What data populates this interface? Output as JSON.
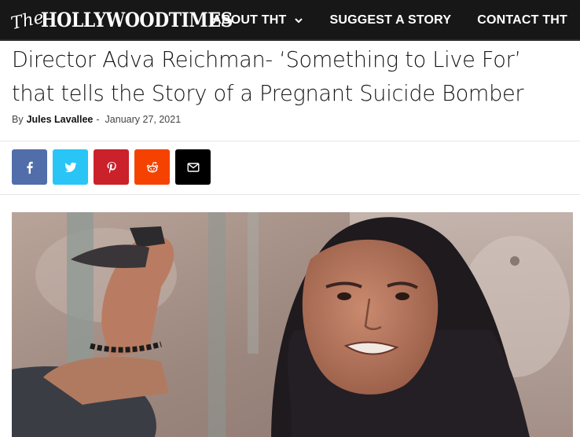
{
  "site": {
    "logo_the": "The",
    "logo_main": "HOLLYWOODTIMES"
  },
  "nav": {
    "items": [
      {
        "label": "ABOUT THT",
        "has_dropdown": true
      },
      {
        "label": "SUGGEST A STORY",
        "has_dropdown": false
      },
      {
        "label": "CONTACT THT",
        "has_dropdown": false
      }
    ]
  },
  "article": {
    "title": "Director Adva Reichman-  ‘Something to Live For’ that tells the Story of a Pregnant Suicide Bomber",
    "by_label": "By",
    "author": "Jules Lavallee",
    "separator": "-",
    "date": "January 27, 2021"
  },
  "share": {
    "buttons": [
      {
        "icon": "facebook-icon",
        "color": "#516eab"
      },
      {
        "icon": "twitter-icon",
        "color": "#29c5f6"
      },
      {
        "icon": "pinterest-icon",
        "color": "#ca212a"
      },
      {
        "icon": "reddit-icon",
        "color": "#f54200"
      },
      {
        "icon": "email-icon",
        "color": "#000000"
      }
    ]
  },
  "colors": {
    "navbar_bg": "#171717",
    "nav_text": "#ffffff"
  }
}
